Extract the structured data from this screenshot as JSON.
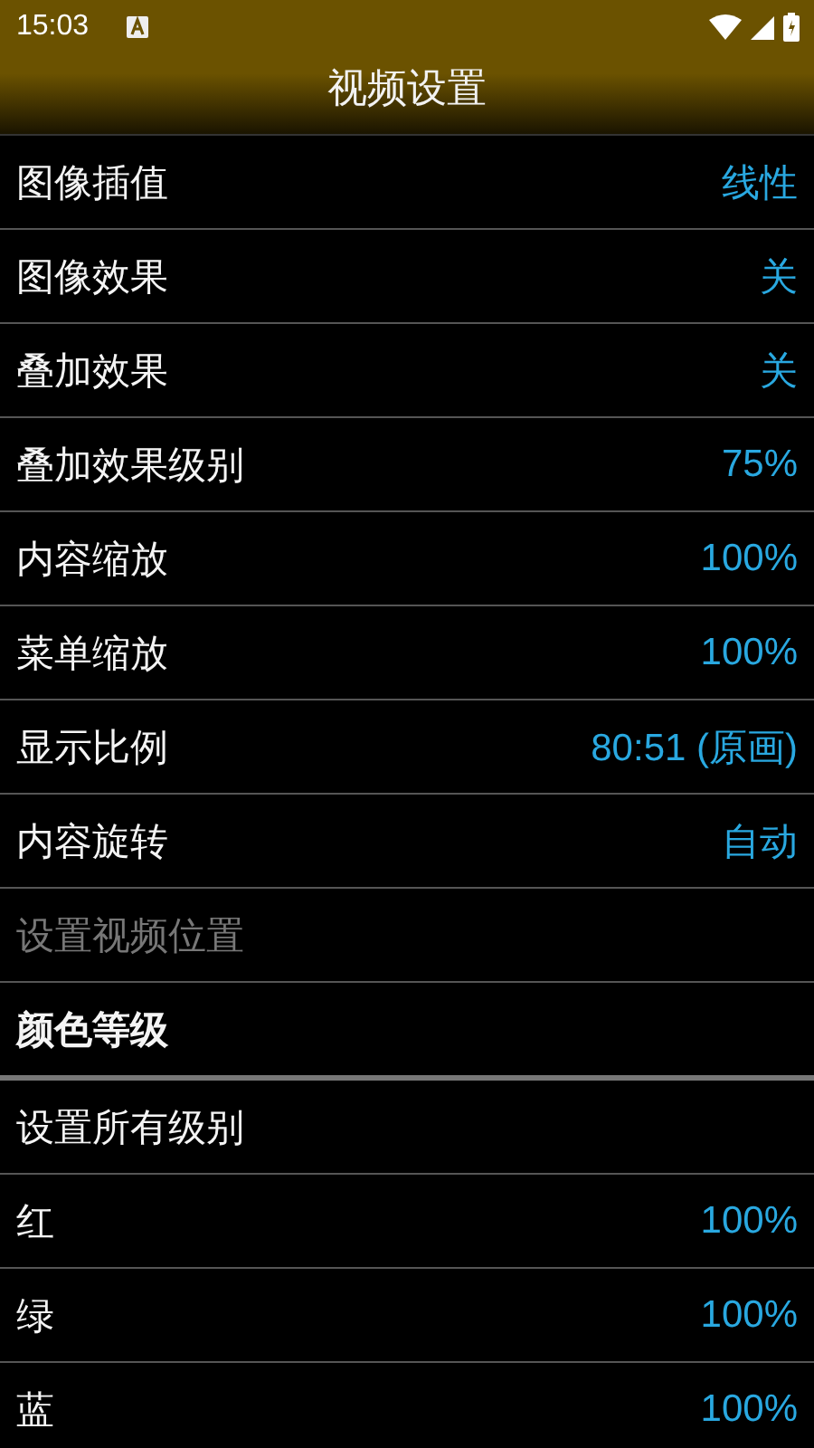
{
  "status_bar": {
    "time": "15:03"
  },
  "title": "视频设置",
  "items": [
    {
      "kind": "setting",
      "label": "图像插值",
      "value": "线性"
    },
    {
      "kind": "setting",
      "label": "图像效果",
      "value": "关"
    },
    {
      "kind": "setting",
      "label": "叠加效果",
      "value": "关"
    },
    {
      "kind": "setting",
      "label": "叠加效果级别",
      "value": "75%"
    },
    {
      "kind": "setting",
      "label": "内容缩放",
      "value": "100%"
    },
    {
      "kind": "setting",
      "label": "菜单缩放",
      "value": "100%"
    },
    {
      "kind": "setting",
      "label": "显示比例",
      "value": "80:51 (原画)"
    },
    {
      "kind": "setting",
      "label": "内容旋转",
      "value": "自动"
    },
    {
      "kind": "setting",
      "label": "设置视频位置",
      "disabled": true
    },
    {
      "kind": "header",
      "label": "颜色等级"
    },
    {
      "kind": "setting",
      "label": "设置所有级别"
    },
    {
      "kind": "setting",
      "label": "红",
      "value": "100%"
    },
    {
      "kind": "setting",
      "label": "绿",
      "value": "100%"
    },
    {
      "kind": "setting",
      "label": "蓝",
      "value": "100%"
    }
  ]
}
